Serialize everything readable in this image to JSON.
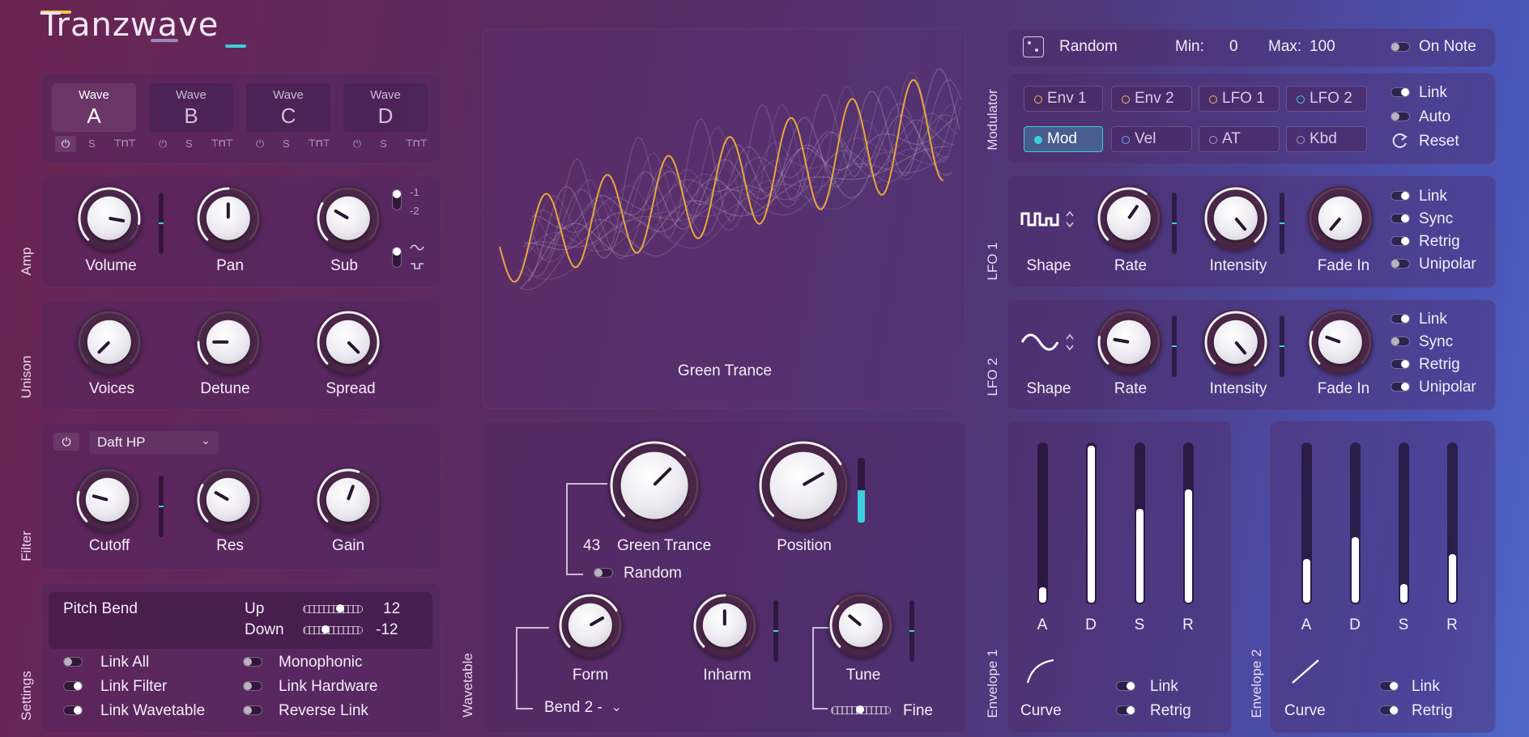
{
  "logo": {
    "text": "Tranzwave"
  },
  "waves": {
    "word": "Wave",
    "slots": [
      {
        "letter": "A",
        "active": true
      },
      {
        "letter": "B",
        "active": false
      },
      {
        "letter": "C",
        "active": false
      },
      {
        "letter": "D",
        "active": false
      }
    ],
    "s_label": "S"
  },
  "amp": {
    "section": "Amp",
    "volume": "Volume",
    "pan": "Pan",
    "sub": "Sub",
    "sub_opt1": "-1",
    "sub_opt2": "-2"
  },
  "unison": {
    "section": "Unison",
    "voices": "Voices",
    "detune": "Detune",
    "spread": "Spread"
  },
  "filter": {
    "section": "Filter",
    "type": "Daft HP",
    "cutoff": "Cutoff",
    "res": "Res",
    "gain": "Gain"
  },
  "settings": {
    "section": "Settings",
    "pitch_bend": "Pitch Bend",
    "up_label": "Up",
    "up_value": "12",
    "down_label": "Down",
    "down_value": "-12",
    "toggles_left": [
      "Link All",
      "Link Filter",
      "Link Wavetable"
    ],
    "toggles_right": [
      "Monophonic",
      "Link Hardware",
      "Reverse Link"
    ]
  },
  "display": {
    "wavetable_name": "Green Trance"
  },
  "wavetable": {
    "section": "Wavetable",
    "index": "43",
    "name": "Green Trance",
    "position": "Position",
    "random": "Random",
    "form": "Form",
    "inharm": "Inharm",
    "tune": "Tune",
    "bend_select": "Bend 2 -",
    "fine": "Fine"
  },
  "random_bar": {
    "label": "Random",
    "min_label": "Min:",
    "min_value": "0",
    "max_label": "Max:",
    "max_value": "100",
    "on_note": "On Note"
  },
  "modulator": {
    "section": "Modulator",
    "buttons": [
      "Env 1",
      "Env 2",
      "LFO 1",
      "LFO 2",
      "Mod",
      "Vel",
      "AT",
      "Kbd"
    ],
    "options": [
      "Link",
      "Auto",
      "Reset"
    ],
    "dot_colors": {
      "env": "#f0b84a",
      "lfo": "#3ad0dc",
      "mod": "#3ad0dc",
      "vel": "#6aa6ff",
      "at": "#9aa0c0",
      "kbd": "#9aa0c0"
    }
  },
  "lfo1": {
    "section": "LFO 1",
    "shape": "Shape",
    "rate": "Rate",
    "intensity": "Intensity",
    "fade_in": "Fade In",
    "options": [
      "Link",
      "Sync",
      "Retrig",
      "Unipolar"
    ]
  },
  "lfo2": {
    "section": "LFO 2",
    "shape": "Shape",
    "rate": "Rate",
    "intensity": "Intensity",
    "fade_in": "Fade In",
    "options": [
      "Link",
      "Sync",
      "Retrig",
      "Unipolar"
    ]
  },
  "env1": {
    "section": "Envelope 1",
    "labels": [
      "A",
      "D",
      "S",
      "R"
    ],
    "levels": [
      0.1,
      1.0,
      0.6,
      0.72
    ],
    "curve": "Curve",
    "link": "Link",
    "retrig": "Retrig"
  },
  "env2": {
    "section": "Envelope 2",
    "labels": [
      "A",
      "D",
      "S",
      "R"
    ],
    "levels": [
      0.28,
      0.42,
      0.12,
      0.31
    ],
    "curve": "Curve",
    "link": "Link",
    "retrig": "Retrig"
  },
  "colors": {
    "accent": "#3ad0dc",
    "wave_gold": "#e8a83a",
    "text": "#f4eef8"
  }
}
